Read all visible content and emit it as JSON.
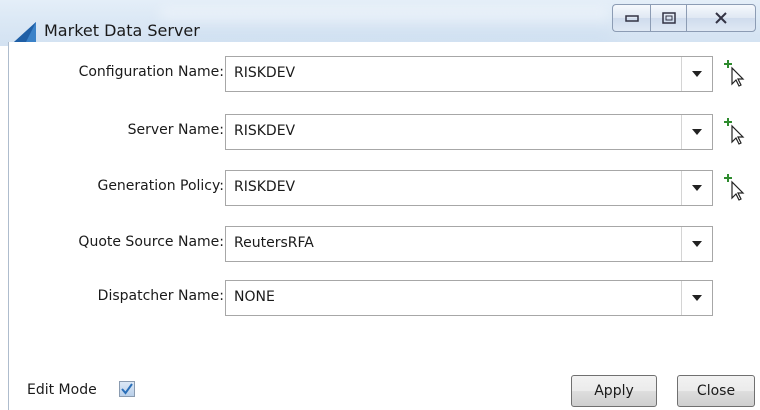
{
  "window": {
    "title": "Market Data Server",
    "icon": "app-sail-icon",
    "caption_buttons": [
      "minimize-icon",
      "maximize-icon",
      "close-icon"
    ]
  },
  "fields": [
    {
      "label": "Configuration Name:",
      "value": "RISKDEV",
      "has_add": true
    },
    {
      "label": "Server Name:",
      "value": "RISKDEV",
      "has_add": true
    },
    {
      "label": "Generation Policy:",
      "value": "RISKDEV",
      "has_add": true
    },
    {
      "label": "Quote Source Name:",
      "value": "ReutersRFA",
      "has_add": false
    },
    {
      "label": "Dispatcher Name:",
      "value": "NONE",
      "has_add": false
    }
  ],
  "footer": {
    "edit_mode_label": "Edit Mode",
    "edit_mode_checked": true,
    "apply_label": "Apply",
    "close_label": "Close"
  },
  "colors": {
    "accent": "#2a6fb8",
    "plus": "#2e8b2e"
  }
}
